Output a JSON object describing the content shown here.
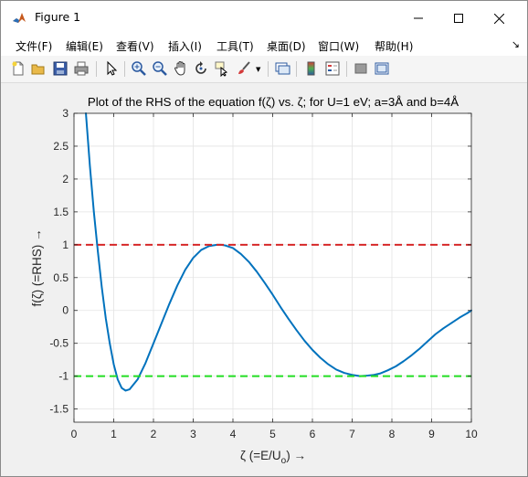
{
  "window": {
    "title": "Figure 1",
    "minimize_glyph": "—",
    "maximize_glyph": "☐",
    "close_glyph": "✕"
  },
  "menu": {
    "items": [
      "文件(F)",
      "编辑(E)",
      "查看(V)",
      "插入(I)",
      "工具(T)",
      "桌面(D)",
      "窗口(W)",
      "帮助(H)"
    ],
    "overflow_glyph": "↘"
  },
  "toolbar": {
    "icons": [
      "new-figure-icon",
      "open-file-icon",
      "save-icon",
      "print-icon",
      "select-arrow-icon",
      "zoom-in-icon",
      "zoom-out-icon",
      "pan-icon",
      "rotate-3d-icon",
      "data-cursor-icon",
      "brush-icon",
      "link-plot-icon",
      "colorbar-icon",
      "legend-icon",
      "hide-plot-tools-icon",
      "show-plot-tools-icon"
    ]
  },
  "chart_data": {
    "type": "line",
    "title": "Plot of the RHS of the equation f(ζ) vs. ζ; for U=1 eV; a=3Å and b=4Å",
    "xlabel": "ζ (=E/U",
    "xlabel_sub": "o",
    "xlabel_arrow": ") →",
    "ylabel": "f(ζ) (=RHS) →",
    "xlim": [
      0,
      10
    ],
    "ylim": [
      -1.7,
      3
    ],
    "xticks": [
      0,
      1,
      2,
      3,
      4,
      5,
      6,
      7,
      8,
      9,
      10
    ],
    "yticks": [
      -1.5,
      -1,
      -0.5,
      0,
      0.5,
      1,
      1.5,
      2,
      2.5,
      3
    ],
    "ytick_labels": [
      "-1.5",
      "-1",
      "-0.5",
      "0",
      "0.5",
      "1",
      "1.5",
      "2",
      "2.5",
      "3"
    ],
    "grid": true,
    "series": [
      {
        "color": "#0072BD",
        "style": "solid",
        "x": [
          0.3,
          0.4,
          0.5,
          0.6,
          0.7,
          0.8,
          0.9,
          1.0,
          1.1,
          1.2,
          1.3,
          1.4,
          1.6,
          1.8,
          2.0,
          2.2,
          2.4,
          2.6,
          2.8,
          3.0,
          3.2,
          3.4,
          3.6,
          3.7,
          3.8,
          4.0,
          4.2,
          4.4,
          4.6,
          4.8,
          5.0,
          5.2,
          5.4,
          5.6,
          5.8,
          6.0,
          6.2,
          6.4,
          6.6,
          6.8,
          7.0,
          7.2,
          7.4,
          7.55,
          7.7,
          7.9,
          8.1,
          8.3,
          8.5,
          8.7,
          8.9,
          9.1,
          9.3,
          9.5,
          9.7,
          9.9,
          10.0
        ],
        "y": [
          3.0,
          2.2,
          1.5,
          0.9,
          0.35,
          -0.12,
          -0.5,
          -0.82,
          -1.05,
          -1.18,
          -1.22,
          -1.2,
          -1.05,
          -0.8,
          -0.5,
          -0.2,
          0.1,
          0.38,
          0.62,
          0.8,
          0.92,
          0.98,
          1.0,
          1.0,
          0.99,
          0.95,
          0.86,
          0.74,
          0.59,
          0.42,
          0.24,
          0.05,
          -0.13,
          -0.3,
          -0.46,
          -0.6,
          -0.72,
          -0.82,
          -0.9,
          -0.95,
          -0.98,
          -1.0,
          -0.99,
          -0.98,
          -0.96,
          -0.91,
          -0.85,
          -0.77,
          -0.68,
          -0.58,
          -0.47,
          -0.36,
          -0.27,
          -0.19,
          -0.11,
          -0.04,
          0.0
        ]
      },
      {
        "color": "#D62728",
        "style": "dashed",
        "x": [
          0,
          10
        ],
        "y": [
          1,
          1
        ]
      },
      {
        "color": "#22DD22",
        "style": "dashed",
        "x": [
          0,
          10
        ],
        "y": [
          -1,
          -1
        ]
      }
    ]
  }
}
